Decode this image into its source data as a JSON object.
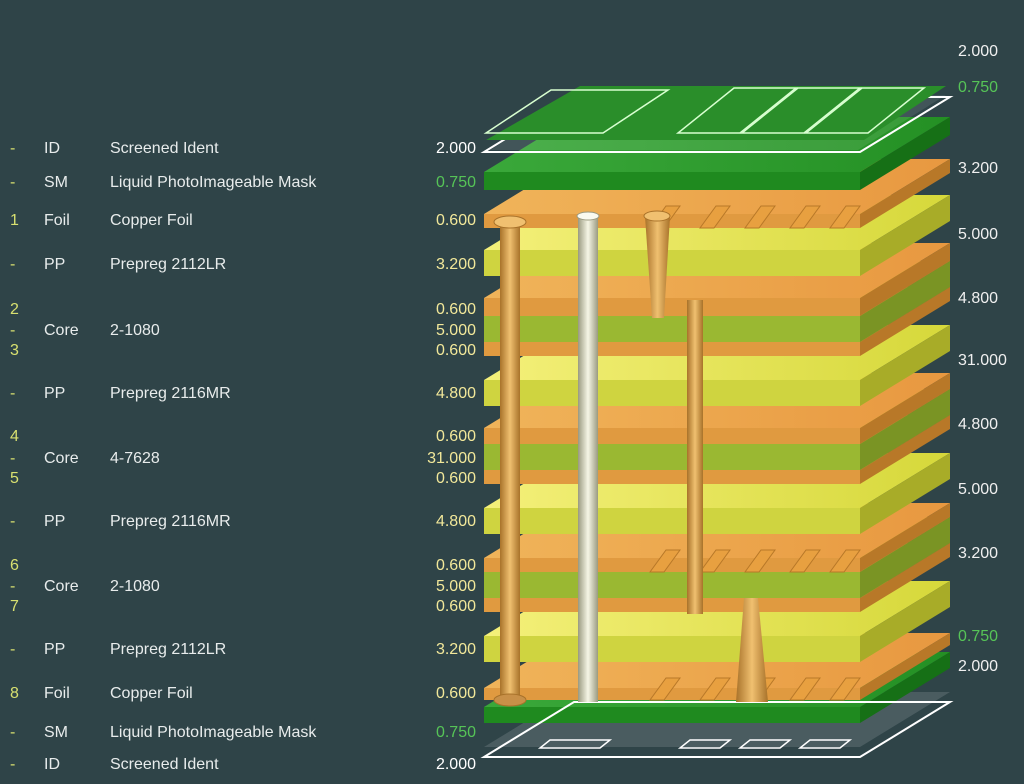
{
  "stackup": [
    {
      "layer": "-",
      "type": "ID",
      "description": "Screened Ident",
      "thickness": "2.000",
      "color": "white"
    },
    {
      "layer": "-",
      "type": "SM",
      "description": "Liquid PhotoImageable Mask",
      "thickness": "0.750",
      "color": "green"
    },
    {
      "layer": "1",
      "type": "Foil",
      "description": "Copper Foil",
      "thickness": "0.600",
      "color": "yellow"
    },
    {
      "layer": "-",
      "type": "PP",
      "description": "Prepreg 2112LR",
      "thickness": "3.200",
      "color": "yellow"
    },
    {
      "layer": "2",
      "type": "",
      "description": "",
      "thickness": "0.600",
      "color": "yellow"
    },
    {
      "layer": "-",
      "type": "Core",
      "description": "2-1080",
      "thickness": "5.000",
      "color": "yellow"
    },
    {
      "layer": "3",
      "type": "",
      "description": "",
      "thickness": "0.600",
      "color": "yellow"
    },
    {
      "layer": "-",
      "type": "PP",
      "description": "Prepreg 2116MR",
      "thickness": "4.800",
      "color": "yellow"
    },
    {
      "layer": "4",
      "type": "",
      "description": "",
      "thickness": "0.600",
      "color": "yellow"
    },
    {
      "layer": "-",
      "type": "Core",
      "description": "4-7628",
      "thickness": "31.000",
      "color": "yellow"
    },
    {
      "layer": "5",
      "type": "",
      "description": "",
      "thickness": "0.600",
      "color": "yellow"
    },
    {
      "layer": "-",
      "type": "PP",
      "description": "Prepreg 2116MR",
      "thickness": "4.800",
      "color": "yellow"
    },
    {
      "layer": "6",
      "type": "",
      "description": "",
      "thickness": "0.600",
      "color": "yellow"
    },
    {
      "layer": "-",
      "type": "Core",
      "description": "2-1080",
      "thickness": "5.000",
      "color": "yellow"
    },
    {
      "layer": "7",
      "type": "",
      "description": "",
      "thickness": "0.600",
      "color": "yellow"
    },
    {
      "layer": "-",
      "type": "PP",
      "description": "Prepreg 2112LR",
      "thickness": "3.200",
      "color": "yellow"
    },
    {
      "layer": "8",
      "type": "Foil",
      "description": "Copper Foil",
      "thickness": "0.600",
      "color": "yellow"
    },
    {
      "layer": "-",
      "type": "SM",
      "description": "Liquid PhotoImageable Mask",
      "thickness": "0.750",
      "color": "green"
    },
    {
      "layer": "-",
      "type": "ID",
      "description": "Screened Ident",
      "thickness": "2.000",
      "color": "white"
    }
  ],
  "right_labels": [
    "2.000",
    "0.750",
    "3.200",
    "5.000",
    "4.800",
    "31.000",
    "4.800",
    "5.000",
    "3.200",
    "0.750",
    "2.000"
  ],
  "colors": {
    "background": "#2f4448",
    "copper": "#e8a040",
    "prepreg": "#e0e24a",
    "core": "#9ab832",
    "solder_mask": "#2e9a2e",
    "silkscreen": "#ffffff"
  }
}
